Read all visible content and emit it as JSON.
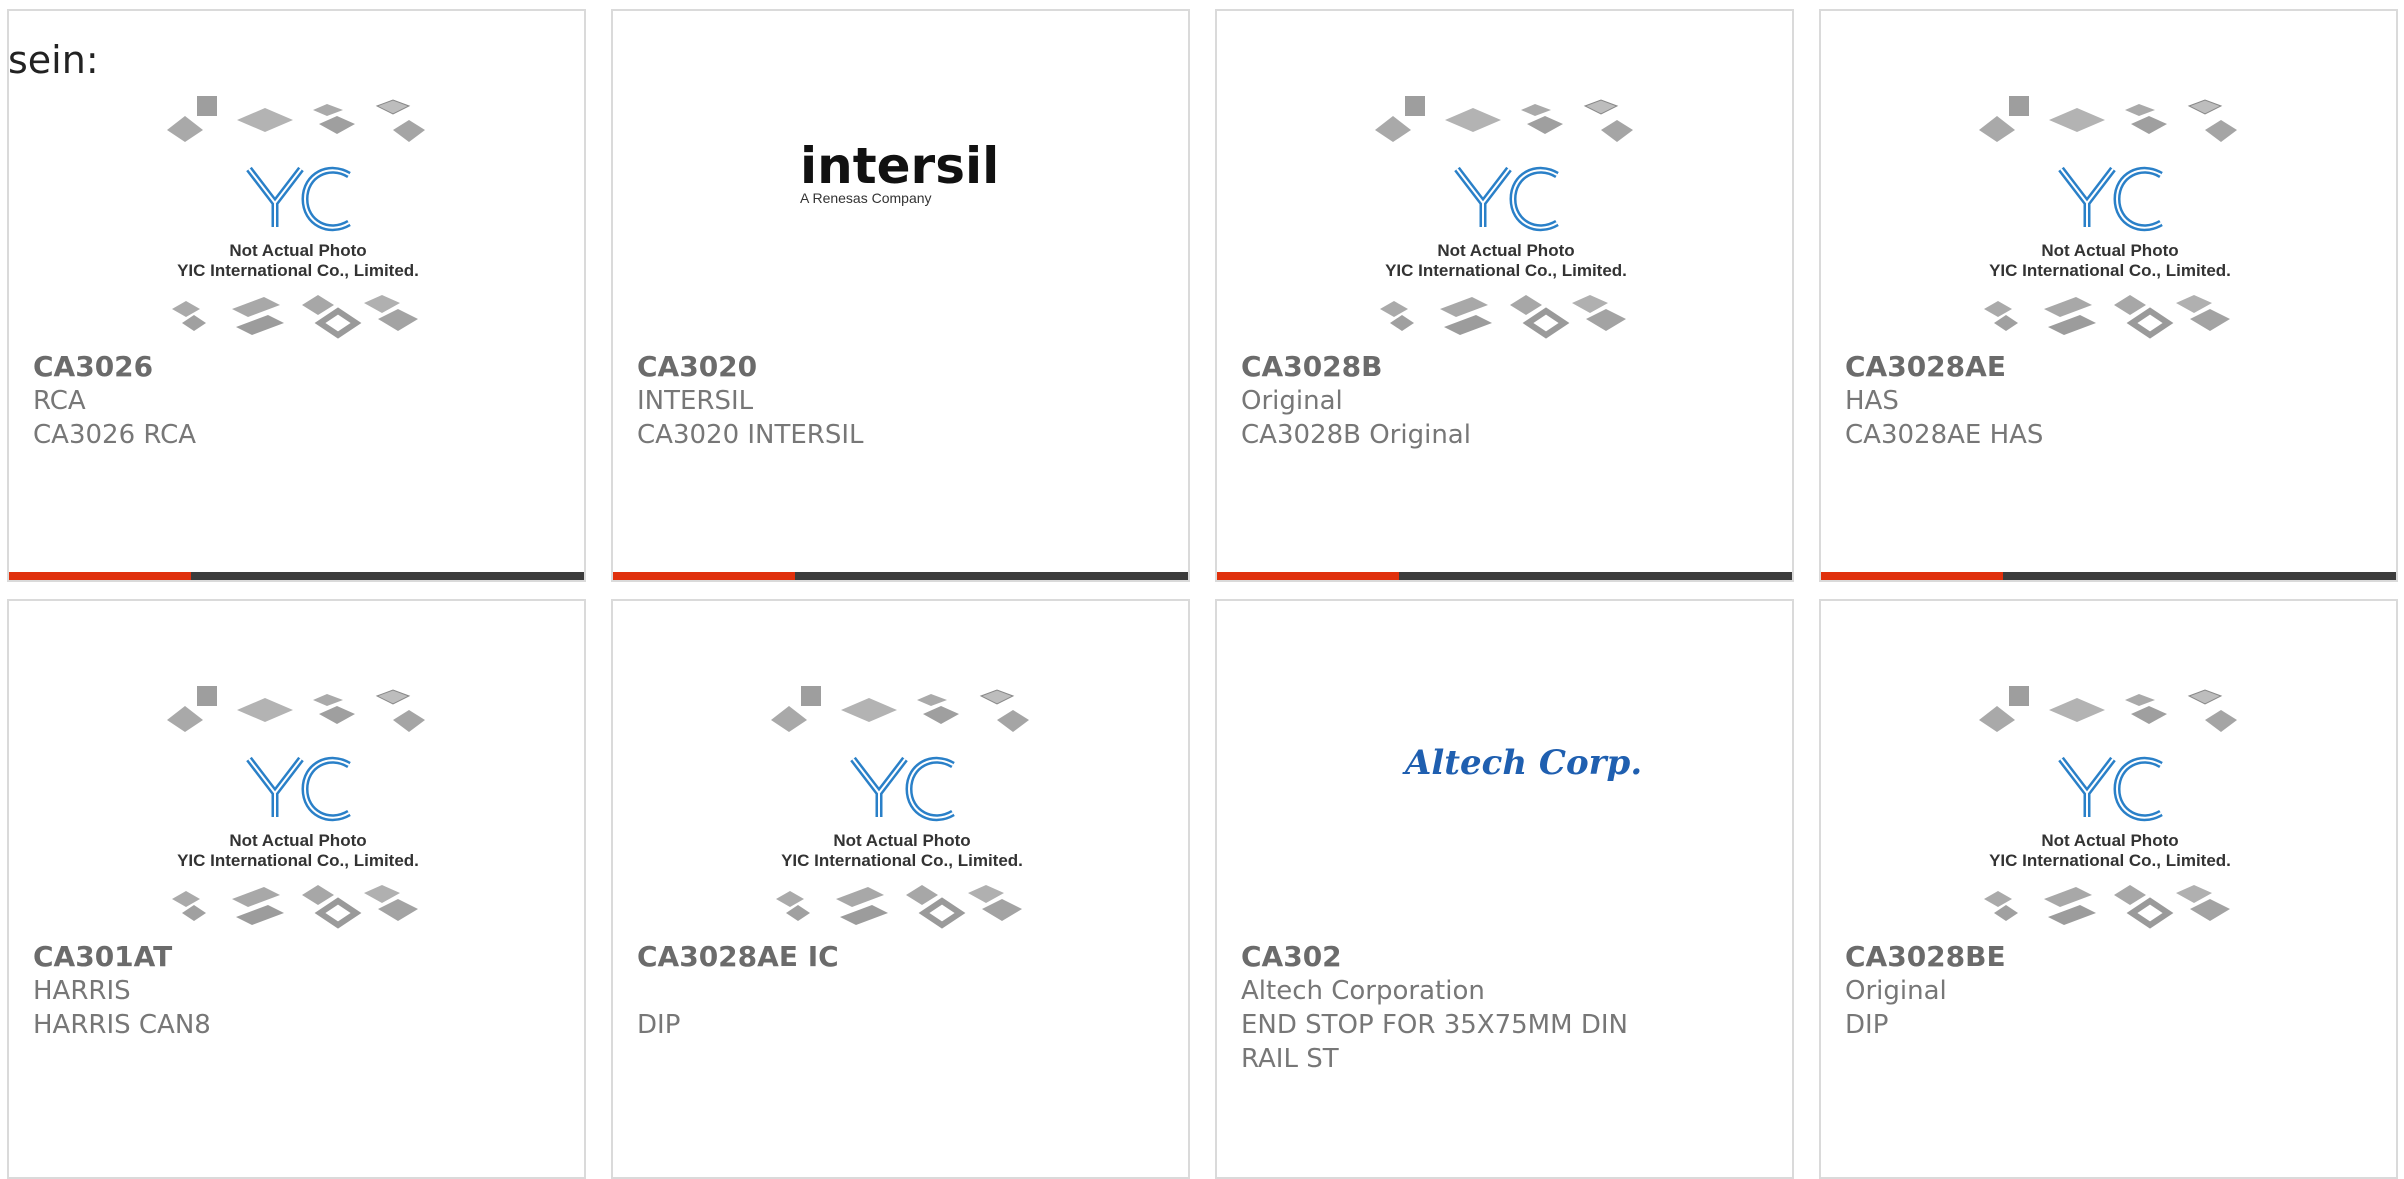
{
  "header_text": "sein:",
  "placeholder": {
    "caption_line1": "Not Actual Photo",
    "caption_line2": "YIC International Co., Limited.",
    "logo_text": "YIC"
  },
  "brand_logos": {
    "intersil_main": "intersil",
    "intersil_sub": "A Renesas Company",
    "altech": "Altech Corp."
  },
  "accent_color": "#e0300c",
  "bar_color": "#3c3c3c",
  "products": [
    {
      "part": "CA3026",
      "maker": "RCA",
      "desc": "CA3026 RCA",
      "image": "yic-placeholder"
    },
    {
      "part": "CA3020",
      "maker": "INTERSIL",
      "desc": "CA3020 INTERSIL",
      "image": "intersil-logo"
    },
    {
      "part": "CA3028B",
      "maker": "Original",
      "desc": "CA3028B Original",
      "image": "yic-placeholder"
    },
    {
      "part": "CA3028AE",
      "maker": "HAS",
      "desc": "CA3028AE HAS",
      "image": "yic-placeholder"
    },
    {
      "part": "CA301AT",
      "maker": "HARRIS",
      "desc": "HARRIS CAN8",
      "image": "yic-placeholder"
    },
    {
      "part": "CA3028AE IC",
      "maker": "",
      "desc": "DIP",
      "image": "yic-placeholder"
    },
    {
      "part": "CA302",
      "maker": "Altech Corporation",
      "desc": "END STOP FOR 35X75MM DIN RAIL ST",
      "image": "altech-logo"
    },
    {
      "part": "CA3028BE",
      "maker": "Original",
      "desc": "DIP",
      "image": "yic-placeholder"
    }
  ]
}
